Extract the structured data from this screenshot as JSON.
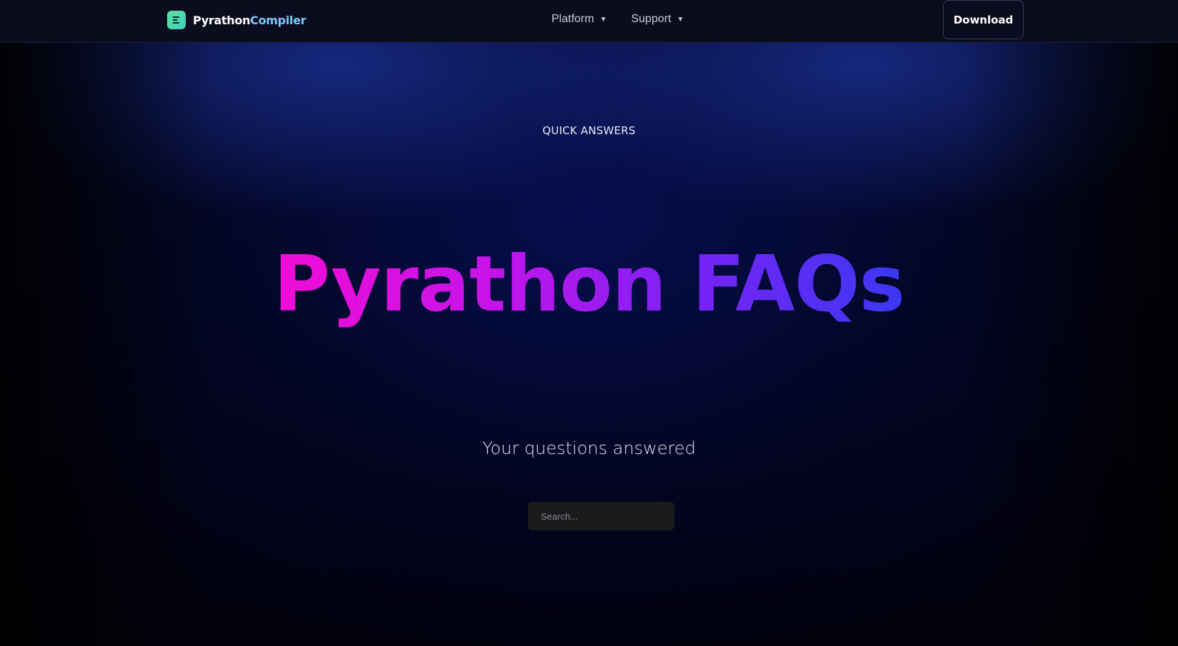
{
  "nav": {
    "brand_part1": "Pyrathon",
    "brand_part2": "Compiler",
    "menu": [
      {
        "label": "Platform"
      },
      {
        "label": "Support"
      }
    ],
    "download_label": "Download"
  },
  "hero": {
    "eyebrow": "QUICK ANSWERS",
    "title": "Pyrathon FAQs",
    "subtitle": "Your questions answered",
    "search_placeholder": "Search..."
  },
  "colors": {
    "title_gradient_start": "#f20cd6",
    "title_gradient_end": "#3b38f2",
    "brand_accent": "#7cc9ff",
    "logo_green": "#5ee2a0"
  }
}
